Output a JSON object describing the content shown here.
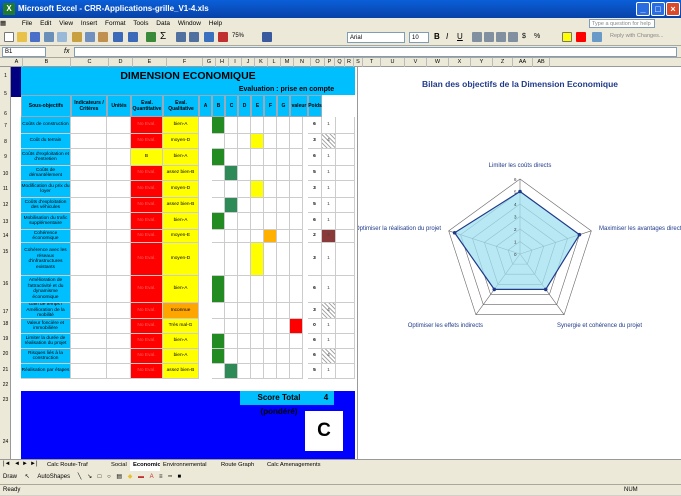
{
  "window": {
    "title": "Microsoft Excel - CRR-Applications-grille_V1-4.xls"
  },
  "menu": [
    "File",
    "Edit",
    "View",
    "Insert",
    "Format",
    "Tools",
    "Data",
    "Window",
    "Help"
  ],
  "help_placeholder": "Type a question for help",
  "toolbar": {
    "zoom": "75%",
    "font": "Arial",
    "size": "10",
    "reply": "Reply with Changes..."
  },
  "formula": {
    "cell_ref": "B1",
    "fx": "fx",
    "value": ""
  },
  "columns": [
    "A",
    "B",
    "C",
    "D",
    "E",
    "F",
    "G",
    "H",
    "I",
    "J",
    "K",
    "L",
    "M",
    "N",
    "O",
    "P",
    "Q",
    "R",
    "S",
    "T",
    "U",
    "V",
    "W",
    "X",
    "Y",
    "Z",
    "AA",
    "AB",
    "AC"
  ],
  "rows": [
    "1",
    "5",
    "6",
    "7",
    "8",
    "9",
    "10",
    "11",
    "12",
    "13",
    "14",
    "15",
    "16",
    "17",
    "18",
    "19",
    "20",
    "21",
    "22",
    "23",
    "24"
  ],
  "sheet": {
    "title": "DIMENSION ECONOMIQUE",
    "eval_header": "Evaluation : prise en compte",
    "headers": [
      "Sous-objectifs",
      "Indicateurs / Critères",
      "Unités",
      "Eval. Quantitative",
      "Eval. Qualitative",
      "A",
      "B",
      "C",
      "D",
      "E",
      "F",
      "G",
      "valeur",
      "Poids"
    ],
    "rows": [
      {
        "label": "Coûts de construction",
        "quant": "No Eval.",
        "qual": "bien-A",
        "value": "6",
        "weight": "1"
      },
      {
        "label": "Coût du terrain",
        "quant": "No Eval.",
        "qual": "moyen-D",
        "value": "3",
        "weight": "4"
      },
      {
        "label": "Coûts d'exploitation et d'entretien",
        "quant": "B",
        "qual": "bien-A",
        "value": "6",
        "weight": "1"
      },
      {
        "label": "Coûts de démantèlement",
        "quant": "No Eval.",
        "qual": "assez bien-B",
        "value": "5",
        "weight": "1"
      },
      {
        "label": "Modification du prix du loyer",
        "quant": "No Eval.",
        "qual": "moyen-D",
        "value": "3",
        "weight": "1"
      },
      {
        "label": "Coûts d'exploitation des véhicules",
        "quant": "No Eval.",
        "qual": "assez bien-B",
        "value": "5",
        "weight": "1"
      },
      {
        "label": "Mobilisation du trafic supplémentaire",
        "quant": "No Eval.",
        "qual": "bien-A",
        "value": "6",
        "weight": "1"
      },
      {
        "label": "Cohérence économique",
        "quant": "No Eval.",
        "qual": "moyen-E",
        "value": "2",
        "weight": "3"
      },
      {
        "label": "Cohérence avec les réseaux d'infrastructures existants",
        "quant": "No Eval.",
        "qual": "moyen-D",
        "value": "3",
        "weight": "1"
      },
      {
        "label": "Amélioration de l'attractivité et du dynamisme économique",
        "quant": "No Eval.",
        "qual": "bien-A",
        "value": "6",
        "weight": "1"
      },
      {
        "label": "Gain de temps / Amélioration de la mobilité",
        "quant": "No Eval.",
        "qual": "Inconnue",
        "value": "3",
        "weight": "4"
      },
      {
        "label": "Valeur foncière et immobilière",
        "quant": "No Eval.",
        "qual": "Très mal-G",
        "value": "0",
        "weight": "1"
      },
      {
        "label": "Limiter la durée de réalisation du projet",
        "quant": "No Eval.",
        "qual": "bien-A",
        "value": "6",
        "weight": "1"
      },
      {
        "label": "Risques liés à la construction",
        "quant": "No Eval.",
        "qual": "bien-A",
        "value": "6",
        "weight": "4"
      },
      {
        "label": "Réalisation par étapes",
        "quant": "No Eval.",
        "qual": "assez bien-B",
        "value": "5",
        "weight": "1"
      }
    ],
    "score_label": "Score Total (pondéré)",
    "score_value": "4",
    "grade": "C"
  },
  "chart": {
    "title": "Bilan des objectifs de la Dimension Economique",
    "axes": [
      "Limiter les coûts directs",
      "Maximiser les avantages directs",
      "Synergie et cohérence du projet",
      "Optimiser les effets indirects",
      "Optimiser la réalisation du projet"
    ],
    "ticks": [
      "0",
      "1",
      "2",
      "3",
      "4",
      "5",
      "6"
    ]
  },
  "chart_data": {
    "type": "radar",
    "title": "Bilan des objectifs de la Dimension Economique",
    "categories": [
      "Limiter les coûts directs",
      "Maximiser les avantages directs",
      "Synergie et cohérence du projet",
      "Optimiser les effets indirects",
      "Optimiser la réalisation du projet"
    ],
    "series": [
      {
        "values": [
          5,
          5,
          3.5,
          3.5,
          5.5
        ]
      }
    ],
    "rlim": [
      0,
      6
    ],
    "ticks": [
      0,
      1,
      2,
      3,
      4,
      5,
      6
    ]
  },
  "tabs": [
    "Calc Route-Traf",
    "Social",
    "Economic",
    "Environnemental",
    "Route Graph",
    "Calc Amenagements"
  ],
  "active_tab": "Economic",
  "drawbar": {
    "draw": "Draw",
    "autoshapes": "AutoShapes"
  },
  "status": {
    "left": "Ready",
    "num": "NUM"
  },
  "colors": {
    "blue_header": "#00bfff",
    "red": "#ff0000",
    "yellow": "#ffff00",
    "green": "#008000",
    "orange": "#ffa500",
    "title_bar": "#0a5fd8"
  }
}
